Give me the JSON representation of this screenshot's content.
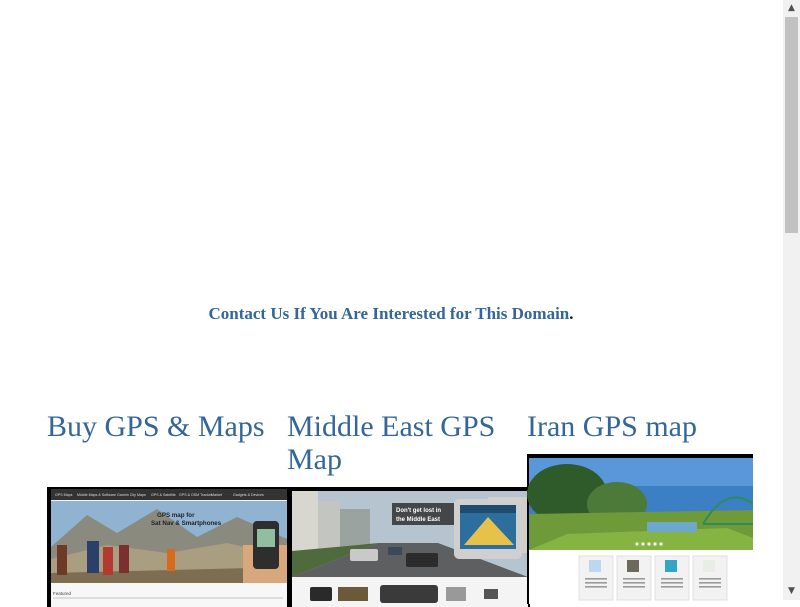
{
  "contact": {
    "link_text": "Contact Us If You Are Interested for This Domain",
    "period": "."
  },
  "columns": [
    {
      "title": "Buy GPS & Maps",
      "thumb": {
        "nav_items": [
          "GPS Maps",
          "Middle Maps & Software",
          "Garmin City Maps",
          "GPS & Satellite",
          "GPS & OSM Tracker",
          "Market",
          "Gadgets & Devices"
        ],
        "headline_1": "GPS map for",
        "headline_2": "Sat Nav & Smartphones",
        "footer_label": "Featured"
      }
    },
    {
      "title": "Middle East GPS Map",
      "thumb": {
        "banner_1": "Don't get lost in",
        "banner_2": "the Middle East"
      }
    },
    {
      "title": "Iran GPS map",
      "thumb": {}
    }
  ],
  "colors": {
    "link": "#336699",
    "text": "#222222",
    "scroll_track": "#f1f1f1",
    "scroll_thumb": "#c1c1c1"
  },
  "scrollbar": {
    "up_icon": "arrow-up-icon",
    "down_icon": "arrow-down-icon"
  }
}
